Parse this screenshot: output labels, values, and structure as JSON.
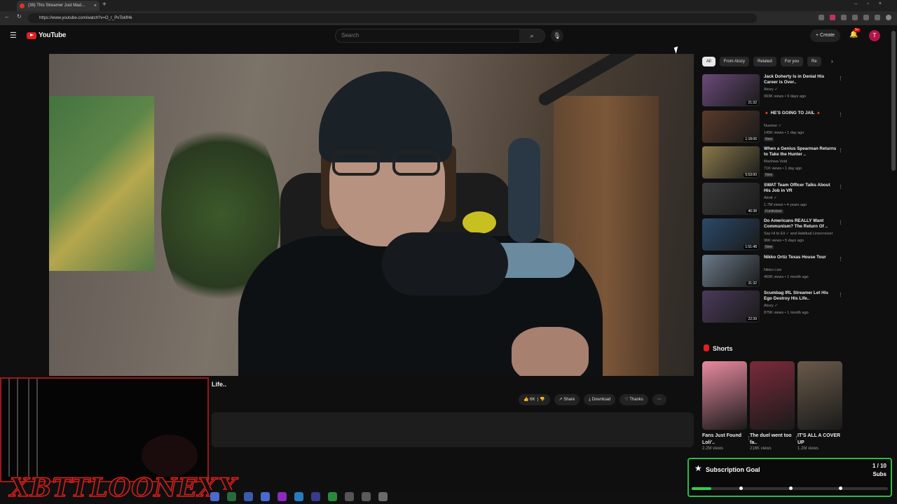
{
  "browser": {
    "tab_title": "(38) This Streamer Just Mad...",
    "url": "https://www.youtube.com/watch?v=O_r_PvTokfHk"
  },
  "header": {
    "logo_text": "YouTube",
    "search_placeholder": "Search",
    "create_label": "+ Create",
    "notif_count": "9+",
    "avatar_letter": "T"
  },
  "video": {
    "title_fragment": "Life..",
    "likes": "6K",
    "share": "Share",
    "download": "Download",
    "thanks": "Thanks"
  },
  "chips": [
    "All",
    "From Atozy",
    "Related",
    "For you",
    "Re"
  ],
  "recommendations": [
    {
      "title": "Jack Doherty Is in Denial His Career is Over..",
      "channel": "Atozy ✓",
      "meta": "993K views • 9 days ago",
      "duration": "21:32",
      "new": "",
      "thumb": "#6a4a7a"
    },
    {
      "title": "🔺 HE'S GOING TO JAIL 🔺",
      "channel": "Nusmer ✓",
      "meta": "145K views • 1 day ago",
      "duration": "1:18:06",
      "new": "New",
      "thumb": "#5a3a2a"
    },
    {
      "title": "When a Genius Spearman Returns to Take the Hunter ..",
      "channel": "Manhwa Void",
      "meta": "71K views • 1 day ago",
      "duration": "5:53:00",
      "new": "New",
      "thumb": "#8a7a4a"
    },
    {
      "title": "SWAT Team Officer Talks About His Job in VR",
      "channel": "Abnit ✓",
      "meta": "1.7M views • 4 years ago",
      "duration": "46:38",
      "new": "Fundraiser",
      "thumb": "#3a3a3a"
    },
    {
      "title": "Do Americans REALLY Want Communism? The Return Of ..",
      "channel": "Say Hi to Eli ✓ and Habitual Linecrosser",
      "meta": "96K views • 5 days ago",
      "duration": "1:51:48",
      "new": "New",
      "thumb": "#2a4a6a"
    },
    {
      "title": "Nikko Ortiz Texas House Tour",
      "channel": "Nikko Live",
      "meta": "460K views • 1 month ago",
      "duration": "31:32",
      "new": "",
      "thumb": "#6a7a8a"
    },
    {
      "title": "Scumbag IRL Streamer Let His Ego Destroy His Life..",
      "channel": "Atozy ✓",
      "meta": "875K views • 1 month ago",
      "duration": "22:39",
      "new": "",
      "thumb": "#4a3a5a"
    }
  ],
  "shorts": {
    "heading": "Shorts",
    "items": [
      {
        "label": "Fans Just Found Loli'..",
        "views": "2.2M views",
        "color": "#e88aa0"
      },
      {
        "label": "The duel went too fa..",
        "views": "216K views",
        "color": "#7a2a3a"
      },
      {
        "label": "IT'S ALL A COVER UP",
        "views": "1.2M views",
        "color": "#6a5a4a"
      }
    ]
  },
  "overlay": {
    "streamer_name": "XBTTLOONEXX",
    "goal_title": "Subscription Goal",
    "goal_count": "1 / 10",
    "goal_unit": "Subs",
    "goal_progress": 0.1
  }
}
